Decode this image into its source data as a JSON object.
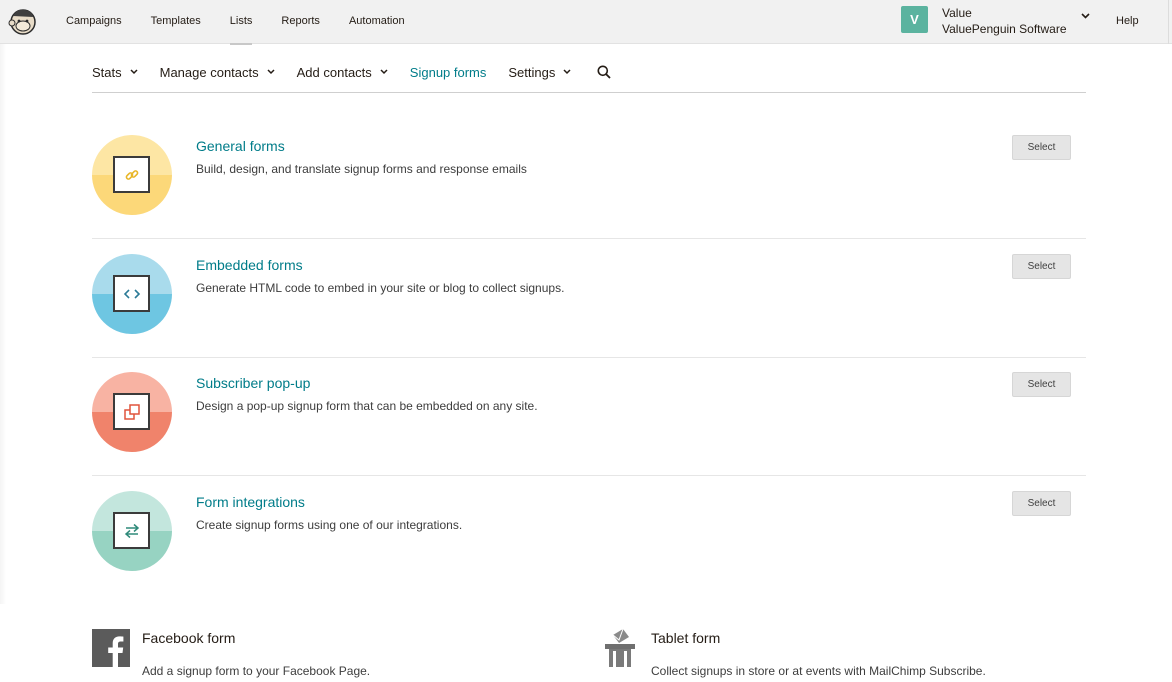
{
  "topnav": {
    "items": [
      "Campaigns",
      "Templates",
      "Lists",
      "Reports",
      "Automation"
    ],
    "active": "Lists",
    "help": "Help"
  },
  "account": {
    "initial": "V",
    "name": "Value",
    "org": "ValuePenguin Software",
    "avatar_color": "#5bb39f"
  },
  "subnav": {
    "items": [
      {
        "label": "Stats",
        "caret": true
      },
      {
        "label": "Manage contacts",
        "caret": true
      },
      {
        "label": "Add contacts",
        "caret": true
      },
      {
        "label": "Signup forms",
        "caret": false,
        "active": true
      },
      {
        "label": "Settings",
        "caret": true
      }
    ],
    "accent": "#007c89"
  },
  "forms": [
    {
      "title": "General forms",
      "description": "Build, design, and translate signup forms and response emails",
      "button": "Select",
      "icon": "link-icon",
      "color_top": "#fde6a4",
      "color_bottom": "#fcd879",
      "glyph_color": "#e8b628"
    },
    {
      "title": "Embedded forms",
      "description": "Generate HTML code to embed in your site or blog to collect signups.",
      "button": "Select",
      "icon": "code-icon",
      "color_top": "#a9dbec",
      "color_bottom": "#6ec6e2",
      "glyph_color": "#2b7a96"
    },
    {
      "title": "Subscriber pop-up",
      "description": "Design a pop-up signup form that can be embedded on any site.",
      "button": "Select",
      "icon": "popup-icon",
      "color_top": "#f8b3a3",
      "color_bottom": "#f0836b",
      "glyph_color": "#e0543b"
    },
    {
      "title": "Form integrations",
      "description": "Create signup forms using one of our integrations.",
      "button": "Select",
      "icon": "arrows-exchange-icon",
      "color_top": "#c3e6dd",
      "color_bottom": "#97d3c2",
      "glyph_color": "#2f8a7a"
    }
  ],
  "bottom": [
    {
      "title": "Facebook form",
      "description": "Add a signup form to your Facebook Page.",
      "icon": "facebook-icon"
    },
    {
      "title": "Tablet form",
      "description": "Collect signups in store or at events with MailChimp Subscribe.",
      "icon": "mailbox-icon"
    }
  ]
}
